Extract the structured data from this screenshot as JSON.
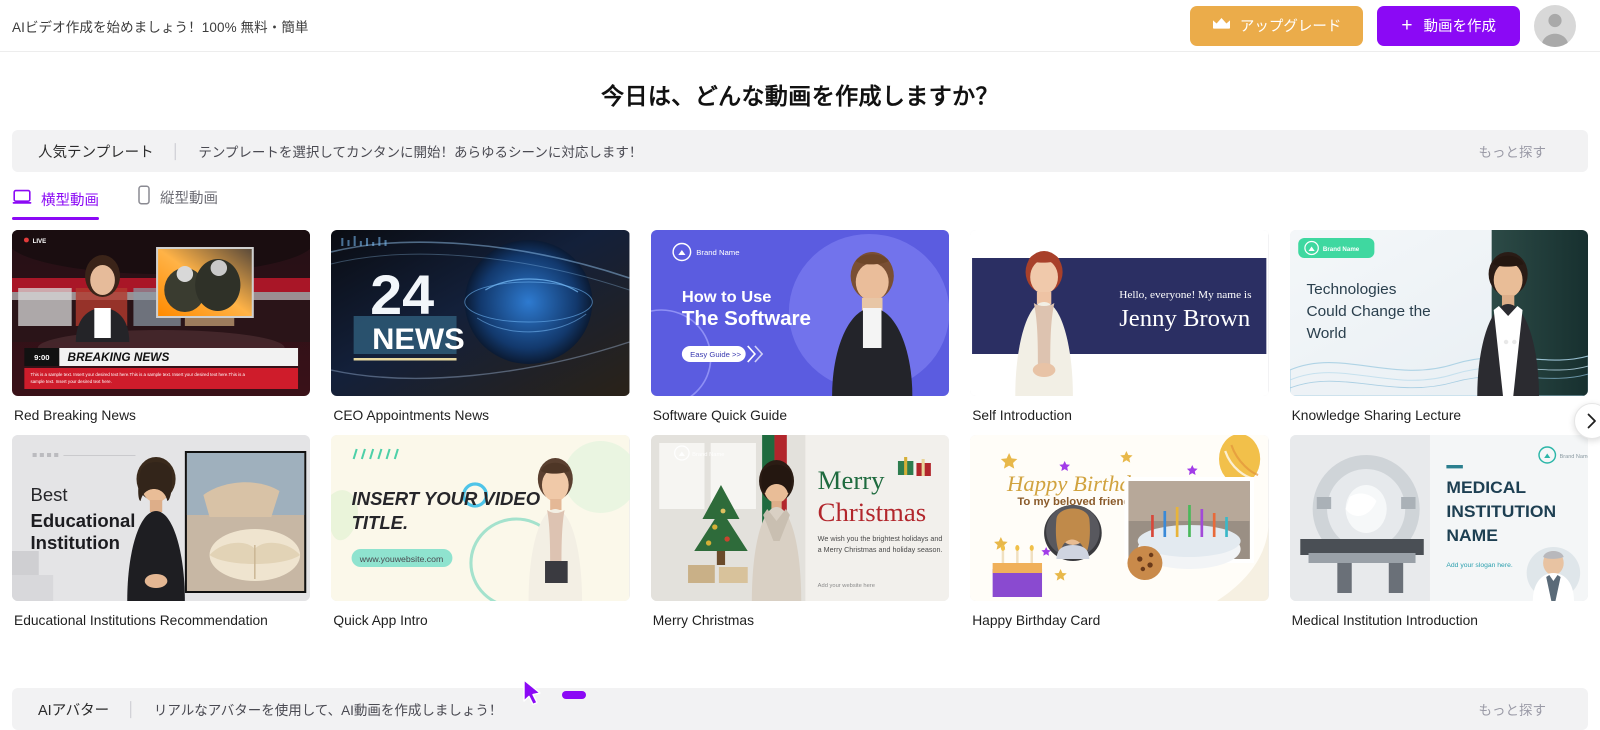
{
  "topbar": {
    "promo": "AIビデオ作成を始めましょう！100% 無料・簡単",
    "upgrade_label": "アップグレード",
    "create_label": "動画を作成",
    "create_plus": "+",
    "avatar_name": "user-avatar"
  },
  "page": {
    "title": "今日は、どんな動画を作成しますか？"
  },
  "section": {
    "title": "人気テンプレート",
    "separator": "│",
    "subtitle": "テンプレートを選択してカンタンに開始！あらゆるシーンに対応します！",
    "more_label": "もっと探す"
  },
  "tabs": [
    {
      "label": "横型動画",
      "icon": "landscape-video-icon",
      "active": true
    },
    {
      "label": "縦型動画",
      "icon": "portrait-video-icon",
      "active": false
    }
  ],
  "templates": [
    {
      "title": "Red Breaking News",
      "thumb": "red-breaking-news-thumbnail",
      "overlay": {
        "live": "LIVE",
        "time": "9:00",
        "headline": "BREAKING NEWS",
        "ticker": "This is a sample text. Insert your desired text here.This is a sample text. Insert your desired text here.This is a sample text. Insert your desired text here."
      }
    },
    {
      "title": "CEO Appointments News",
      "thumb": "ceo-appointments-news-thumbnail",
      "overlay": {
        "number": "24",
        "word": "NEWS"
      }
    },
    {
      "title": "Software Quick Guide",
      "thumb": "software-quick-guide-thumbnail",
      "overlay": {
        "brand": "Brand Name",
        "line1": "How to Use",
        "line2": "The Software",
        "cta": "Easy Guide >>"
      }
    },
    {
      "title": "Self Introduction",
      "thumb": "self-introduction-thumbnail",
      "overlay": {
        "greeting": "Hello, everyone! My name is",
        "name": "Jenny Brown"
      }
    },
    {
      "title": "Knowledge Sharing Lecture",
      "thumb": "knowledge-sharing-lecture-thumbnail",
      "overlay": {
        "brand": "Brand Name",
        "line1": "Technologies",
        "line2": "Could Change the",
        "line3": "World"
      }
    },
    {
      "title": "Educational Institutions Recommendation",
      "thumb": "educational-institutions-thumbnail",
      "overlay": {
        "line1": "Best",
        "line2": "Educational",
        "line3": "Institution"
      }
    },
    {
      "title": "Quick App Intro",
      "thumb": "quick-app-intro-thumbnail",
      "overlay": {
        "line1": "INSERT YOUR VIDEO",
        "line2": "TITLE.",
        "url": "www.youwebsite.com"
      }
    },
    {
      "title": "Merry Christmas",
      "thumb": "merry-christmas-thumbnail",
      "overlay": {
        "brand": "Brand Name",
        "line1": "Merry",
        "line2": "Christmas",
        "body": "We wish you the brightest holidays and a Merry Christmas and holiday season.",
        "footer": "Add your website here"
      }
    },
    {
      "title": "Happy Birthday Card",
      "thumb": "happy-birthday-card-thumbnail",
      "overlay": {
        "line1": "Happy Birthday",
        "line2": "To my beloved friend"
      }
    },
    {
      "title": "Medical Institution Introduction",
      "thumb": "medical-institution-thumbnail",
      "overlay": {
        "brand": "Brand Name",
        "line1": "MEDICAL",
        "line2": "INSTITUTION",
        "line3": "NAME",
        "slogan": "Add your slogan here."
      }
    }
  ],
  "carousel": {
    "next_label": "›"
  },
  "bottom_section": {
    "title": "AIアバター",
    "separator": "│",
    "subtitle": "リアルなアバターを使用して、AI動画を作成しましょう！",
    "more_label": "もっと探す"
  }
}
